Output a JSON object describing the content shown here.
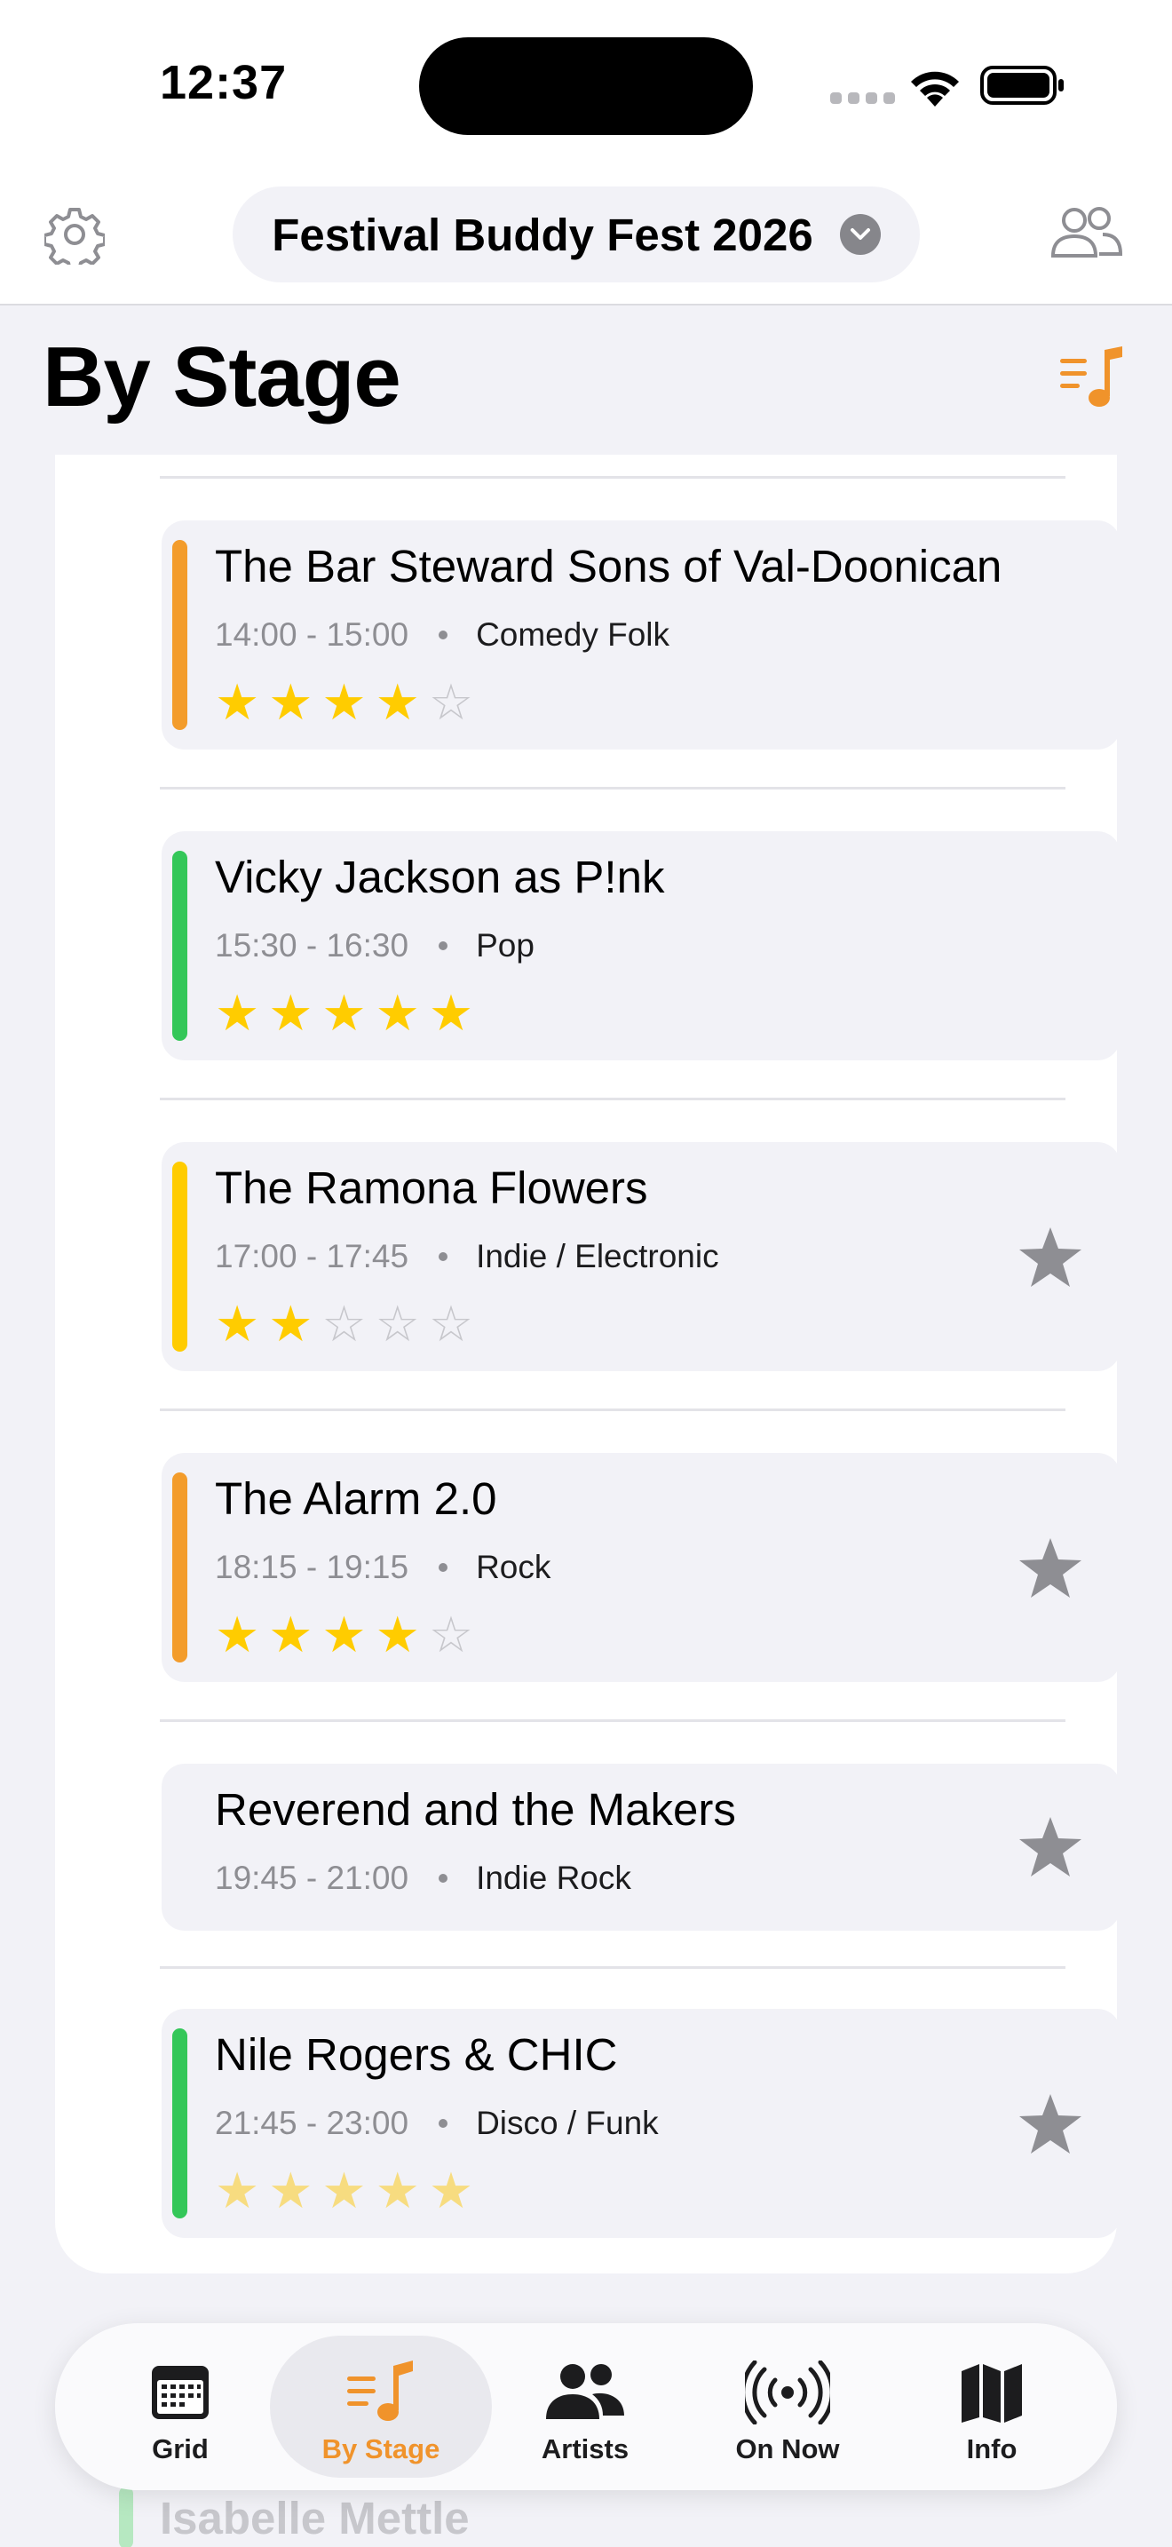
{
  "status": {
    "time": "12:37"
  },
  "header": {
    "festival": "Festival Buddy Fest 2026"
  },
  "page": {
    "title": "By Stage"
  },
  "colors": {
    "accent": "#f0932b",
    "stripe_orange": "#f39c2b",
    "stripe_green": "#34c759",
    "stripe_yellow": "#ffcc00",
    "star": "#ffcc00"
  },
  "events": [
    {
      "name": "The Bar Steward Sons of Val-Doonican",
      "time": "14:00 - 15:00",
      "genre": "Comedy Folk",
      "rating": 4,
      "stripe": "orange",
      "favourite": false
    },
    {
      "name": "Vicky Jackson as P!nk",
      "time": "15:30 - 16:30",
      "genre": "Pop",
      "rating": 5,
      "stripe": "green",
      "favourite": false
    },
    {
      "name": "The Ramona Flowers",
      "time": "17:00 - 17:45",
      "genre": "Indie / Electronic",
      "rating": 2,
      "stripe": "yellow",
      "favourite": true
    },
    {
      "name": "The Alarm 2.0",
      "time": "18:15 - 19:15",
      "genre": "Rock",
      "rating": 4,
      "stripe": "orange",
      "favourite": true
    },
    {
      "name": "Reverend and the Makers",
      "time": "19:45 - 21:00",
      "genre": "Indie Rock",
      "rating": 0,
      "stripe": "none",
      "favourite": true
    },
    {
      "name": "Nile Rogers & CHIC",
      "time": "21:45 - 23:00",
      "genre": "Disco / Funk",
      "rating": 5,
      "stripe": "green",
      "favourite": true
    }
  ],
  "next_event_peek": "Isabelle Mettle",
  "tabs": [
    {
      "label": "Grid",
      "icon": "calendar-grid-icon",
      "active": false
    },
    {
      "label": "By Stage",
      "icon": "music-list-icon",
      "active": true
    },
    {
      "label": "Artists",
      "icon": "people-icon",
      "active": false
    },
    {
      "label": "On Now",
      "icon": "broadcast-icon",
      "active": false
    },
    {
      "label": "Info",
      "icon": "map-icon",
      "active": false
    }
  ]
}
